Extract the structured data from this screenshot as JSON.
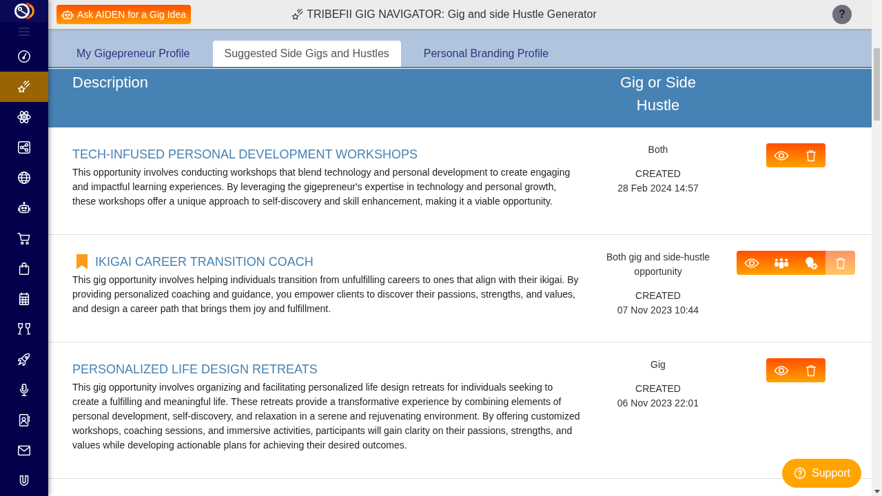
{
  "app": {
    "ask_button": "Ask AIDEN for a Gig Idea",
    "title": "TRIBEFII GIG NAVIGATOR: Gig and side Hustle Generator",
    "help_button": "?"
  },
  "sidebar": {
    "items": [
      {
        "kind": "gauge",
        "selected": false
      },
      {
        "kind": "star",
        "selected": true
      },
      {
        "kind": "atom",
        "selected": false
      },
      {
        "kind": "share",
        "selected": false
      },
      {
        "kind": "globe",
        "selected": false
      },
      {
        "kind": "robot",
        "selected": false
      },
      {
        "kind": "cart",
        "selected": false
      },
      {
        "kind": "bag",
        "selected": false
      },
      {
        "kind": "calendar",
        "selected": false
      },
      {
        "kind": "toast",
        "selected": false
      },
      {
        "kind": "rocket",
        "selected": false
      },
      {
        "kind": "microphone",
        "selected": false
      },
      {
        "kind": "contacts",
        "selected": false
      },
      {
        "kind": "mail",
        "selected": false
      },
      {
        "kind": "magnet",
        "selected": false
      }
    ]
  },
  "tabs": [
    {
      "label": "My Gigepreneur Profile",
      "selected": false
    },
    {
      "label": "Suggested Side Gigs and Hustles",
      "selected": true
    },
    {
      "label": "Personal Branding Profile",
      "selected": false
    }
  ],
  "table": {
    "columns": [
      "Description",
      "Gig or Side Hustle"
    ],
    "rows": [
      {
        "title": "TECH-INFUSED PERSONAL DEVELOPMENT WORKSHOPS",
        "bookmarked": false,
        "description": "This opportunity involves conducting workshops that blend technology and personal development to create engaging and impactful learning experiences. By leveraging the gigepreneur's expertise in technology and personal growth, these workshops offer a unique approach to self-discovery and skill enhancement, making it a viable opportunity.",
        "type": "Both",
        "created_label": "CREATED",
        "created": "28 Feb 2024 14:57",
        "actions": [
          {
            "kind": "view",
            "disabled": false
          },
          {
            "kind": "delete",
            "disabled": false
          }
        ]
      },
      {
        "title": "IKIGAI CAREER TRANSITION COACH",
        "bookmarked": true,
        "description": "This gig opportunity involves helping individuals transition from unfulfilling careers to ones that align with their ikigai. By providing personalized coaching and guidance, you empower clients to discover their passions, strengths, and values, and design a career path that brings them joy and fulfillment.",
        "type": "Both gig and side-hustle opportunity",
        "created_label": "CREATED",
        "created": "07 Nov 2023 10:44",
        "actions": [
          {
            "kind": "view",
            "disabled": false
          },
          {
            "kind": "team",
            "disabled": false
          },
          {
            "kind": "ideas",
            "disabled": false
          },
          {
            "kind": "delete",
            "disabled": true
          }
        ]
      },
      {
        "title": "PERSONALIZED LIFE DESIGN RETREATS",
        "bookmarked": false,
        "description": "This gig opportunity involves organizing and facilitating personalized life design retreats for individuals seeking to create a fulfilling and meaningful life. These retreats provide a transformative experience by combining elements of personal development, self-discovery, and relaxation in a serene and rejuvenating environment. By offering customized workshops, coaching sessions, and immersive activities, participants will gain clarity on their passions, strengths, and values while developing actionable plans for achieving their desired outcomes.",
        "type": "Gig",
        "created_label": "CREATED",
        "created": "06 Nov 2023 22:01",
        "actions": [
          {
            "kind": "view",
            "disabled": false
          },
          {
            "kind": "delete",
            "disabled": false
          }
        ]
      }
    ]
  },
  "support_button": "Support"
}
